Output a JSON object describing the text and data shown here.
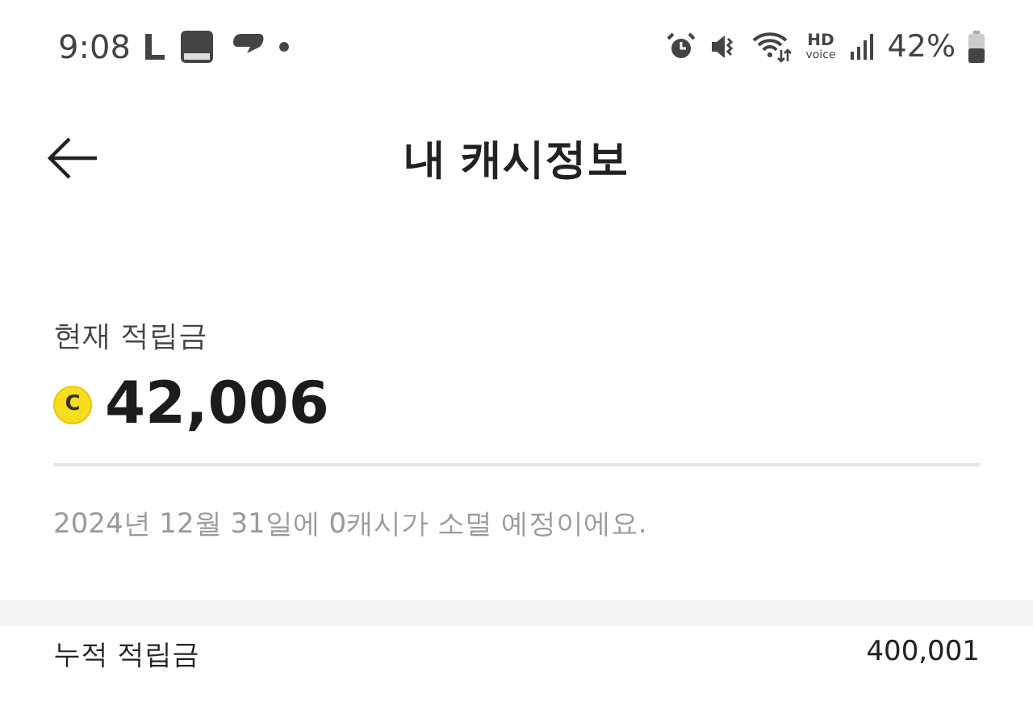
{
  "status_bar": {
    "time": "9:08",
    "hd_label": "HD",
    "voice_label": "voice",
    "battery": "42%"
  },
  "header": {
    "title": "내 캐시정보"
  },
  "balance": {
    "label": "현재 적립금",
    "coin_symbol": "C",
    "amount": "42,006",
    "notice": "2024년 12월 31일에 0캐시가 소멸 예정이에요."
  },
  "summary_rows": [
    {
      "label": "누적 적립금",
      "value": "400,001"
    }
  ]
}
